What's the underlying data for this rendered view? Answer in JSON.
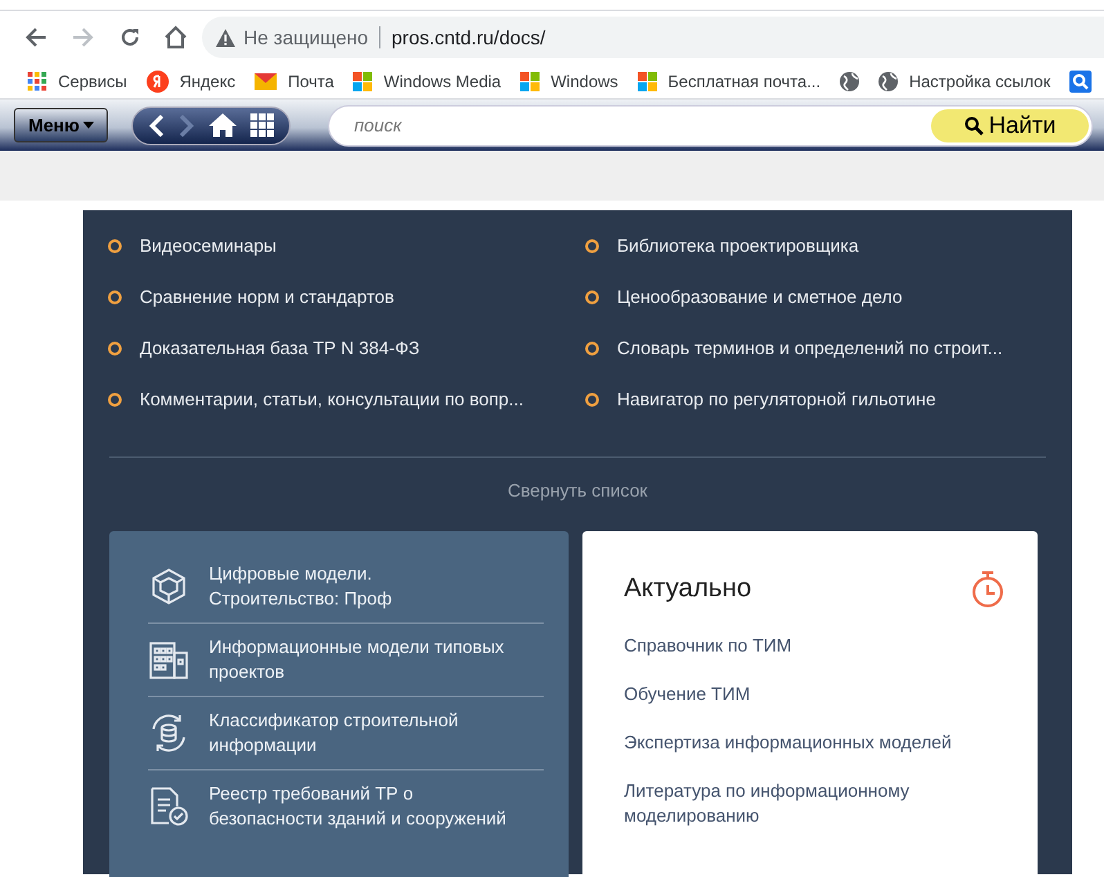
{
  "browser": {
    "security": "Не защищено",
    "url": "pros.cntd.ru/docs/"
  },
  "bookmarks": [
    {
      "kind": "apps",
      "label": "Сервисы"
    },
    {
      "kind": "yandex",
      "label": "Яндекс"
    },
    {
      "kind": "mail",
      "label": "Почта"
    },
    {
      "kind": "windows",
      "label": "Windows Media"
    },
    {
      "kind": "windows",
      "label": "Windows"
    },
    {
      "kind": "windows",
      "label": "Бесплатная почта..."
    },
    {
      "kind": "globe"
    },
    {
      "kind": "globe",
      "label": "Настройка ссылок"
    },
    {
      "kind": "search"
    }
  ],
  "header": {
    "menu": "Меню",
    "search_placeholder": "поиск",
    "search_button": "Найти"
  },
  "links": [
    "Видеосеминары",
    "Библиотека проектировщика",
    "Сравнение норм и стандартов",
    "Ценообразование и сметное дело",
    "Доказательная база ТР N 384-ФЗ",
    "Словарь терминов и определений по строит...",
    "Комментарии, статьи, консультации по вопр...",
    "Навигатор по регуляторной гильотине"
  ],
  "collapse": "Свернуть список",
  "services": [
    {
      "kind": "cube",
      "label": "Цифровые модели.\nСтроительство: Проф"
    },
    {
      "kind": "buildings",
      "label": "Информационные модели типовых проектов"
    },
    {
      "kind": "database",
      "label": "Классификатор строительной информации"
    },
    {
      "kind": "document",
      "label": "Реестр требований ТР о безопасности зданий и сооружений"
    }
  ],
  "actual": {
    "title": "Актуально",
    "links": [
      "Справочник по ТИМ",
      "Обучение ТИМ",
      "Экспертиза информационных моделей",
      "Литература по информационному моделированию"
    ]
  }
}
